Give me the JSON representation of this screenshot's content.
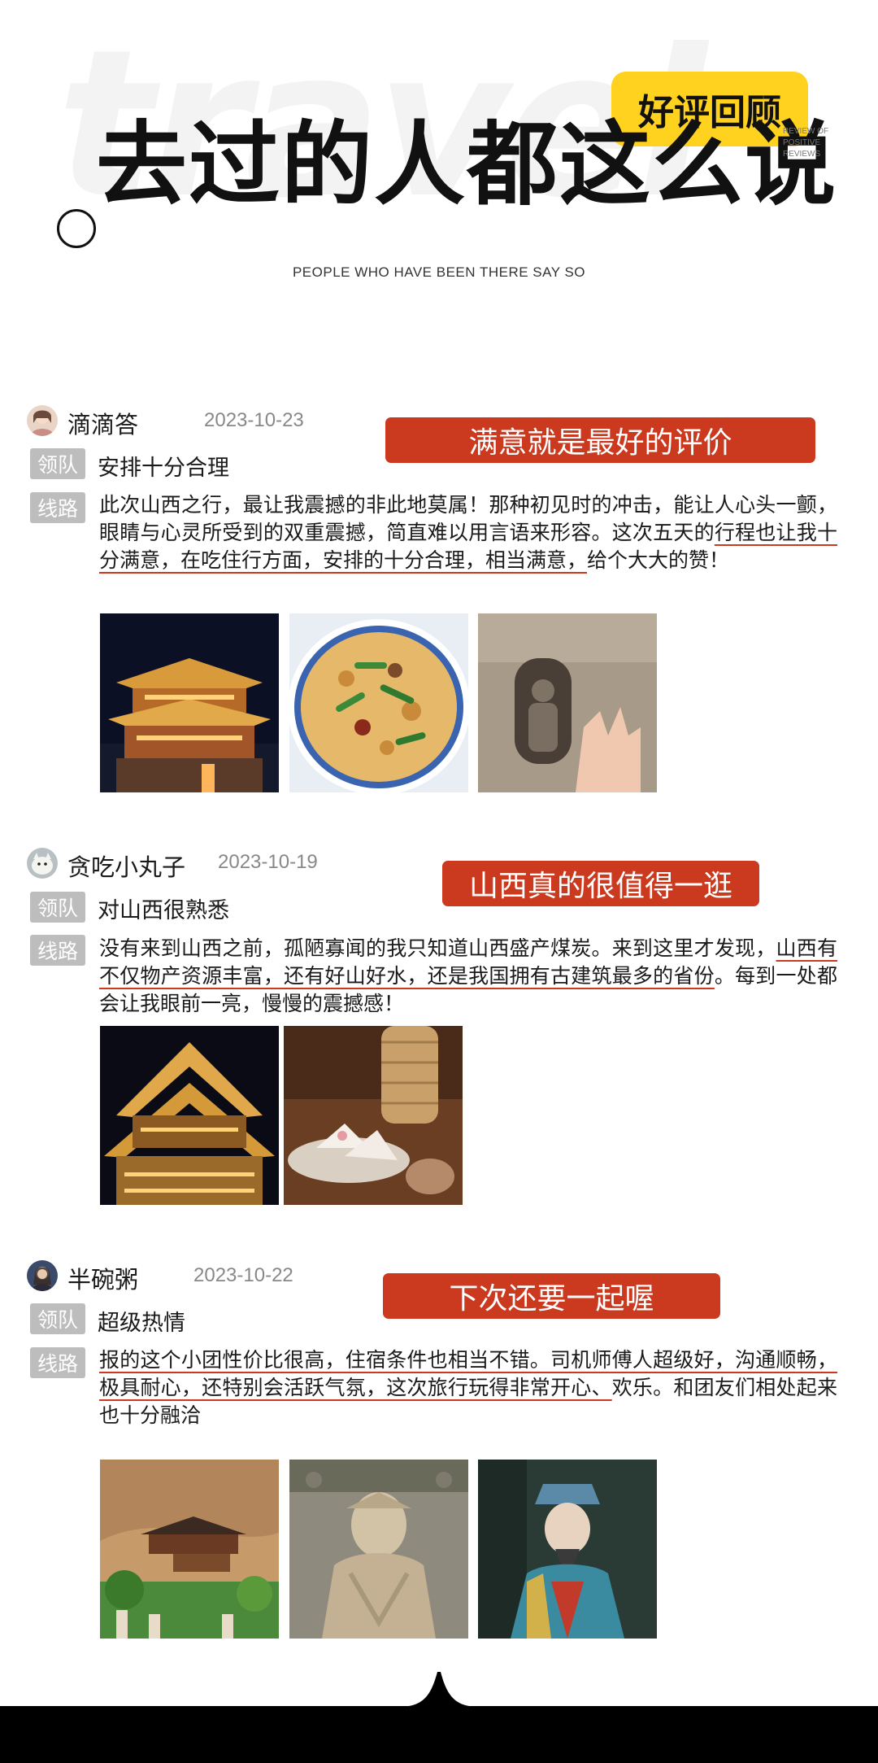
{
  "header": {
    "bg_word": "travel",
    "badge": "好评回顾",
    "title": "去过的人都这么说",
    "review_label": [
      "REVIEW OF",
      "POSITIVE",
      "REVIEWS"
    ],
    "subtitle": "PEOPLE WHO HAVE BEEN THERE SAY SO"
  },
  "colors": {
    "accent_red": "#cb391e",
    "badge_yellow": "#ffd21f",
    "tag_gray": "#bdbdbd"
  },
  "reviews": [
    {
      "user": "滴滴答",
      "date": "2023-10-23",
      "banner": "满意就是最好的评价",
      "team_tag": "领队",
      "team_comment": "安排十分合理",
      "route_tag": "线路",
      "text_before": "此次山西之行，最让我震撼的非此地莫属！那种初见时的冲击，能让人心头一颤，眼睛与心灵所受到的双重震撼，简直难以用言语来形容。这次五天的",
      "text_underline": "行程也让我十分满意，在吃住行方面，安排的十分合理，相当满意，",
      "text_after": "给个大大的赞！",
      "photos": [
        "tower-at-night-photo",
        "fried-dish-photo",
        "grotto-buddha-photo"
      ]
    },
    {
      "user": "贪吃小丸子",
      "date": "2023-10-19",
      "banner": "山西真的很值得一逛",
      "team_tag": "领队",
      "team_comment": "对山西很熟悉",
      "route_tag": "线路",
      "text_before": "没有来到山西之前，孤陋寡闻的我只知道山西盛产煤炭。来到这里才发现，",
      "text_underline": "山西有不仅物产资源丰富，还有好山好水，还是我国拥有古建筑最多的省份",
      "text_after": "。每到一处都会让我眼前一亮，慢慢的震撼感！",
      "photos": [
        "pagoda-roof-photo",
        "dessert-photo"
      ]
    },
    {
      "user": "半碗粥",
      "date": "2023-10-22",
      "banner": "下次还要一起喔",
      "team_tag": "领队",
      "team_comment": "超级热情",
      "route_tag": "线路",
      "text_before": "",
      "text_underline": "报的这个小团性价比很高，住宿条件也相当不错。司机师傅人超级好，沟通顺畅，极具耐心，还特别会活跃气氛，这次旅行玩得非常开心、",
      "text_after": "欢乐。和团友们相处起来也十分融洽",
      "photos": [
        "hanging-temple-photo",
        "stone-buddha-photo",
        "painted-statue-photo"
      ]
    }
  ]
}
